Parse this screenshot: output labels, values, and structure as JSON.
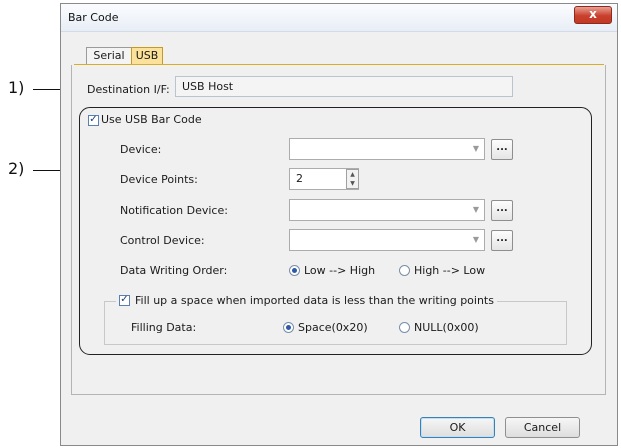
{
  "window": {
    "title": "Bar Code",
    "close_glyph": "x"
  },
  "tabs": [
    {
      "label": "Serial",
      "active": false
    },
    {
      "label": "USB",
      "active": true
    }
  ],
  "destination": {
    "label": "Destination I/F:",
    "value": "USB Host"
  },
  "use_usb": {
    "label": "Use USB Bar Code",
    "checked": true
  },
  "fields": {
    "device": {
      "label": "Device:",
      "value": ""
    },
    "device_points": {
      "label": "Device Points:",
      "value": "2"
    },
    "notification_device": {
      "label": "Notification Device:",
      "value": ""
    },
    "control_device": {
      "label": "Control Device:",
      "value": ""
    }
  },
  "ellipsis_label": "...",
  "data_writing_order": {
    "label": "Data Writing Order:",
    "options": [
      "Low --> High",
      "High --> Low"
    ],
    "selected": "Low --> High"
  },
  "fill_space": {
    "label": "Fill up a space when imported data is less than the writing points",
    "checked": true
  },
  "filling_data": {
    "label": "Filling Data:",
    "options": [
      "Space(0x20)",
      "NULL(0x00)"
    ],
    "selected": "Space(0x20)"
  },
  "buttons": {
    "ok": "OK",
    "cancel": "Cancel"
  },
  "callouts": {
    "one": "1)",
    "two": "2)"
  }
}
